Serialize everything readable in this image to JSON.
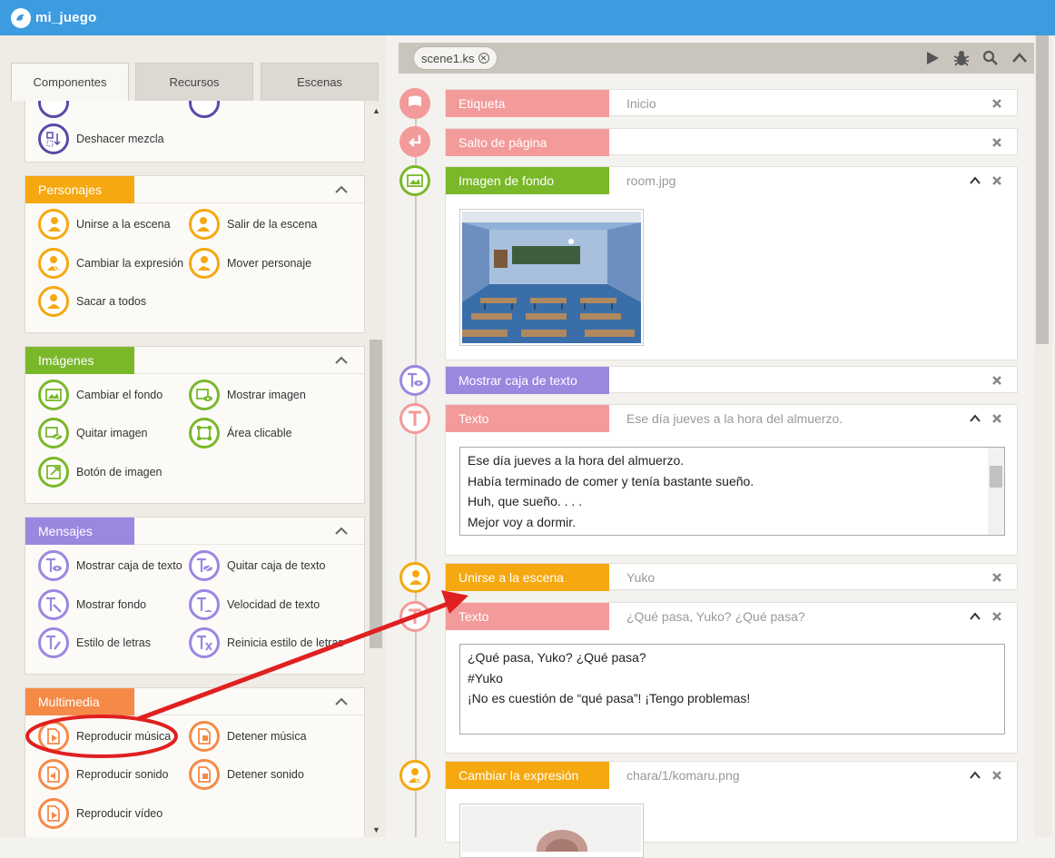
{
  "app": {
    "title": "mi_juego"
  },
  "tabs": [
    {
      "label": "Componentes"
    },
    {
      "label": "Recursos"
    },
    {
      "label": "Escenas"
    }
  ],
  "partial_group": {
    "item": "Deshacer mezcla"
  },
  "groups": [
    {
      "title": "Personajes",
      "color": "#f5a810",
      "items": [
        "Unirse a la escena",
        "Salir de la escena",
        "Cambiar la expresión",
        "Mover personaje",
        "Sacar a todos"
      ]
    },
    {
      "title": "Imágenes",
      "color": "#7ab82a",
      "items": [
        "Cambiar el fondo",
        "Mostrar imagen",
        "Quitar imagen",
        "Área clicable",
        "Botón de imagen"
      ]
    },
    {
      "title": "Mensajes",
      "color": "#9b87e0",
      "items": [
        "Mostrar caja de texto",
        "Quitar caja de texto",
        "Mostrar fondo",
        "Velocidad de texto",
        "Estilo de letras",
        "Reinicia estilo de letras"
      ]
    },
    {
      "title": "Multimedia",
      "color": "#f58a48",
      "items": [
        "Reproducir música",
        "Detener música",
        "Reproducir sonido",
        "Detener sonido",
        "Reproducir vídeo"
      ]
    }
  ],
  "editor": {
    "file_tab": "scene1.ks"
  },
  "blocks": [
    {
      "tag": "Etiqueta",
      "value": "Inicio"
    },
    {
      "tag": "Salto de página",
      "value": ""
    },
    {
      "tag": "Imagen de fondo",
      "value": "room.jpg"
    },
    {
      "tag": "Mostrar caja de texto",
      "value": ""
    },
    {
      "tag": "Texto",
      "value": "Ese día jueves a la hora del almuerzo.",
      "lines": [
        "Ese día jueves a la hora del almuerzo.",
        "Había terminado de comer y tenía bastante sueño.",
        "Huh, que sueño. . . .",
        "Mejor voy a dormir."
      ]
    },
    {
      "tag": "Unirse a la escena",
      "value": "Yuko"
    },
    {
      "tag": "Texto",
      "value": "¿Qué pasa, Yuko? ¿Qué pasa?",
      "lines": [
        "¿Qué pasa, Yuko? ¿Qué pasa?",
        "#Yuko",
        "¡No es cuestión de “qué pasa”! ¡Tengo problemas!"
      ]
    },
    {
      "tag": "Cambiar la expresión",
      "value": "chara/1/komaru.png"
    }
  ],
  "colors": {
    "red": "#f39a9a",
    "green": "#7ab82a",
    "purple": "#9b87e0",
    "orange": "#f5a810",
    "annotation": "#e02020"
  }
}
